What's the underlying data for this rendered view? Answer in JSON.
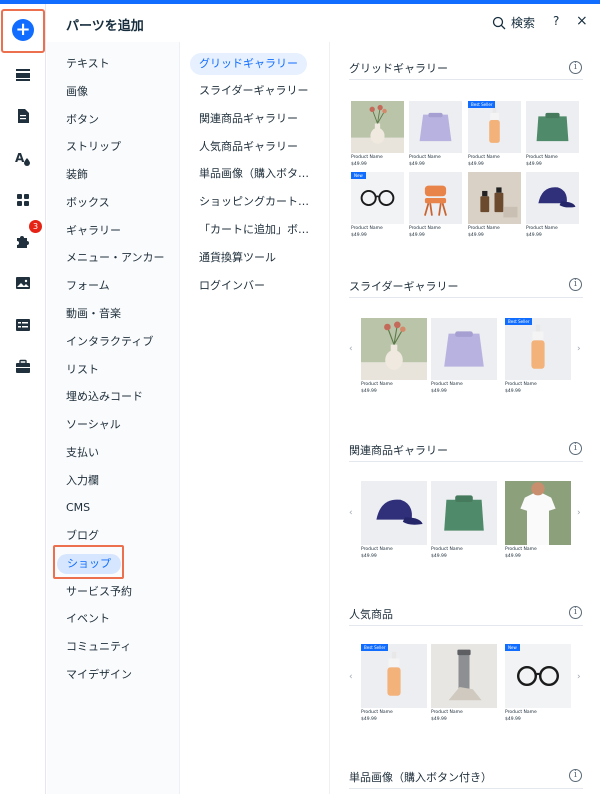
{
  "header": {
    "title": "パーツを追加",
    "search_label": "検索",
    "help_label": "?",
    "close_label": "×"
  },
  "rail": {
    "badge_count": "3"
  },
  "categories": [
    "テキスト",
    "画像",
    "ボタン",
    "ストリップ",
    "装飾",
    "ボックス",
    "ギャラリー",
    "メニュー・アンカー",
    "フォーム",
    "動画・音楽",
    "インタラクティブ",
    "リスト",
    "埋め込みコード",
    "ソーシャル",
    "支払い",
    "入力欄",
    "CMS",
    "ブログ",
    "ショップ",
    "サービス予約",
    "イベント",
    "コミュニティ",
    "マイデザイン"
  ],
  "selected_category": "ショップ",
  "subcategories": [
    "グリッドギャラリー",
    "スライダーギャラリー",
    "関連商品ギャラリー",
    "人気商品ギャラリー",
    "単品画像（購入ボタン付き）",
    "ショッピングカートアイコン",
    "「カートに追加」ボタン",
    "通貨換算ツール",
    "ログインバー"
  ],
  "sections": {
    "grid": {
      "title": "グリッドギャラリー",
      "info": "i"
    },
    "slider": {
      "title": "スライダーギャラリー",
      "info": "i"
    },
    "related": {
      "title": "関連商品ギャラリー",
      "info": "i"
    },
    "popular": {
      "title": "人気商品",
      "info": "i"
    },
    "single": {
      "title": "単品画像（購入ボタン付き）",
      "info": "i"
    }
  },
  "product": {
    "name": "Product Name",
    "price": "$49.99",
    "badge_best": "Best Seller",
    "badge_new": "New"
  },
  "colors": {
    "accent": "#116dff",
    "highlight": "#ec6f4e",
    "badge": "#e62214"
  }
}
